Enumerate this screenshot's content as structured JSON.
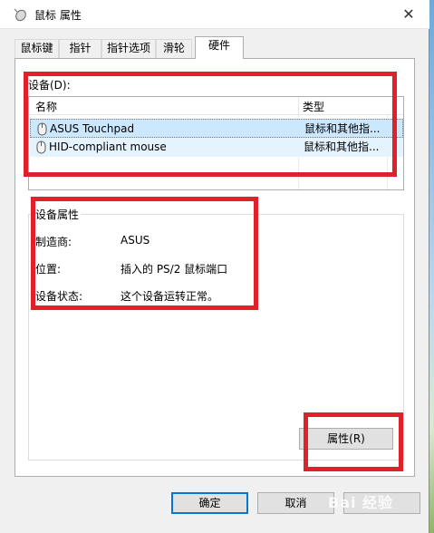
{
  "window": {
    "title": "鼠标 属性",
    "close_glyph": "✕",
    "title_icon": "mouse-icon"
  },
  "tabs": [
    {
      "label": "鼠标键"
    },
    {
      "label": "指针"
    },
    {
      "label": "指针选项"
    },
    {
      "label": "滑轮"
    },
    {
      "label": "硬件"
    }
  ],
  "active_tab": "硬件",
  "devices": {
    "label": "设备(D):",
    "columns": [
      "名称",
      "类型"
    ],
    "rows": [
      {
        "name": "ASUS Touchpad",
        "type": "鼠标和其他指...",
        "selected": true
      },
      {
        "name": "HID-compliant mouse",
        "type": "鼠标和其他指...",
        "selected": false
      }
    ]
  },
  "properties": {
    "title": "设备属性",
    "items": [
      {
        "key": "制造商:",
        "value": "ASUS"
      },
      {
        "key": "位置:",
        "value": "插入的 PS/2 鼠标端口"
      },
      {
        "key": "设备状态:",
        "value": "这个设备运转正常。"
      }
    ],
    "button": "属性(R)"
  },
  "footer": {
    "ok": "确定",
    "cancel": "取消",
    "apply_watermark": "Bai 经验"
  },
  "colors": {
    "highlight": "#e0202a",
    "selection": "#cce8ff",
    "accent": "#0078d7"
  }
}
